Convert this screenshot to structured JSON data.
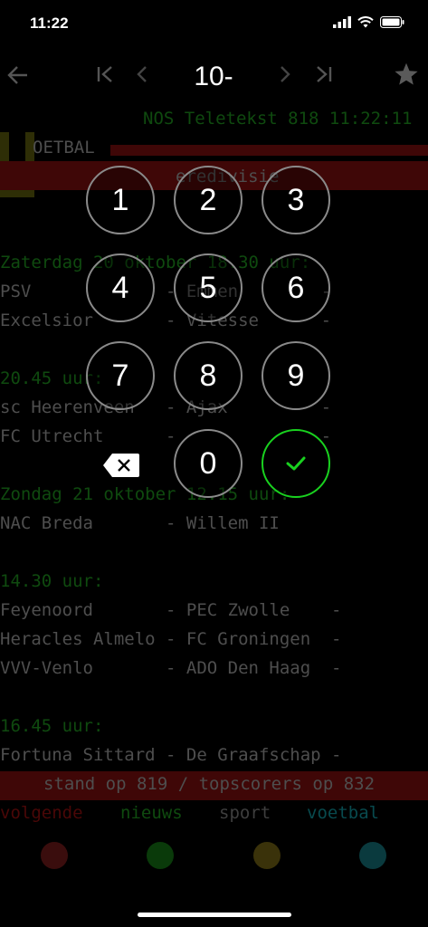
{
  "status_bar": {
    "time": "11:22"
  },
  "nav": {
    "page_number": "10-",
    "back_icon": "arrow-left-icon",
    "first_icon": "skip-first-icon",
    "prev_icon": "chevron-left-icon",
    "next_icon": "chevron-right-icon",
    "last_icon": "skip-last-icon",
    "favorite_icon": "star-icon"
  },
  "teletext": {
    "header": "NOS Teletekst 818 11:22:11",
    "section": "OETBAL",
    "subtitle": "eredivisie",
    "rows": [
      "Zaterdag 20 oktober 18.30 uur:",
      "PSV             - Emmen        -",
      "Excelsior       - Vitesse      -",
      "20.45 uur:",
      "sc Heerenveen   - Ajax         -",
      "FC Utrecht      -              -",
      "Zondag 21 oktober 12.15 uur:",
      "NAC Breda       - Willem II     ",
      "14.30 uur:",
      "Feyenoord       - PEC Zwolle    -",
      "Heracles Almelo - FC Groningen  -",
      "VVV-Venlo       - ADO Den Haag  -",
      "16.45 uur:",
      "Fortuna Sittard - De Graafschap -"
    ],
    "footer_bar": "stand op 819 / topscorers op 832",
    "fastext": [
      "volgende",
      "nieuws",
      "sport",
      "voetbal"
    ]
  },
  "colors": {
    "fastext_dots": [
      "#3a0d0d",
      "#0a3a0a",
      "#3a320a",
      "#0a3a3e"
    ],
    "confirm": "#19d11f"
  },
  "keypad": {
    "keys": [
      "1",
      "2",
      "3",
      "4",
      "5",
      "6",
      "7",
      "8",
      "9",
      "0"
    ],
    "backspace_icon": "backspace-icon",
    "confirm_icon": "checkmark-icon"
  }
}
